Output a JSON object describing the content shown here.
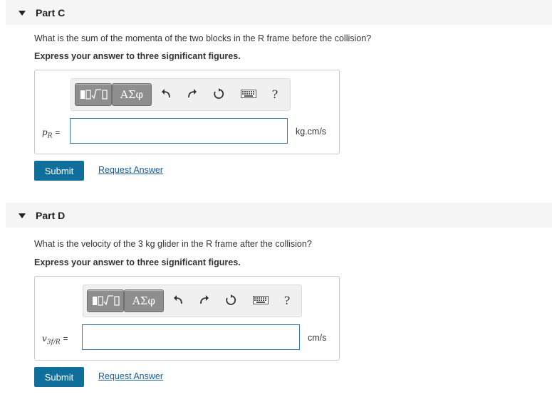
{
  "parts": [
    {
      "title": "Part C",
      "question": "What is the sum of the momenta of the two blocks in the R frame before the collision?",
      "instruction": "Express your answer to three significant figures.",
      "variable_main": "p",
      "variable_sub": "R",
      "equals": "=",
      "unit": "kg.cm/s",
      "submit_label": "Submit",
      "request_label": "Request Answer"
    },
    {
      "title": "Part D",
      "question": "What is the velocity of the 3 kg glider in the R frame after the collision?",
      "instruction": "Express your answer to three significant figures.",
      "variable_main": "v",
      "variable_sub": "3f/R",
      "equals": "=",
      "unit": "cm/s",
      "submit_label": "Submit",
      "request_label": "Request Answer"
    }
  ],
  "toolbar": {
    "greek_label": "ΑΣφ",
    "help_label": "?",
    "icons": [
      "templates-icon",
      "greek-letters-icon",
      "undo-icon",
      "redo-icon",
      "reset-icon",
      "keyboard-icon",
      "help-icon"
    ]
  }
}
